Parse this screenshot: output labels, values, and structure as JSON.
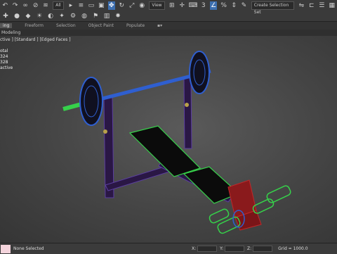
{
  "toolbar": {
    "filter_dropdown": "All",
    "view_dropdown": "View",
    "selection_set": "Create Selection Set"
  },
  "ribbon": {
    "tabs": [
      "ing",
      "Freeform",
      "Selection",
      "Object Paint",
      "Populate"
    ]
  },
  "modeling_label": "Modeling",
  "viewport": {
    "label": "ctive ] [Standard ] [Edged Faces ]",
    "stats": [
      "otal",
      "324",
      "328",
      "",
      "active"
    ]
  },
  "status": {
    "message": "None Selected",
    "x_label": "X:",
    "y_label": "Y:",
    "z_label": "Z:",
    "grid": "Grid = 1000.0"
  },
  "colors": {
    "selection_highlight": "#3d6fb0",
    "wire_blue": "#2f5fd0",
    "wire_green": "#36d14a",
    "wire_red": "#c0282a",
    "wire_purple": "#3b1f5c"
  }
}
